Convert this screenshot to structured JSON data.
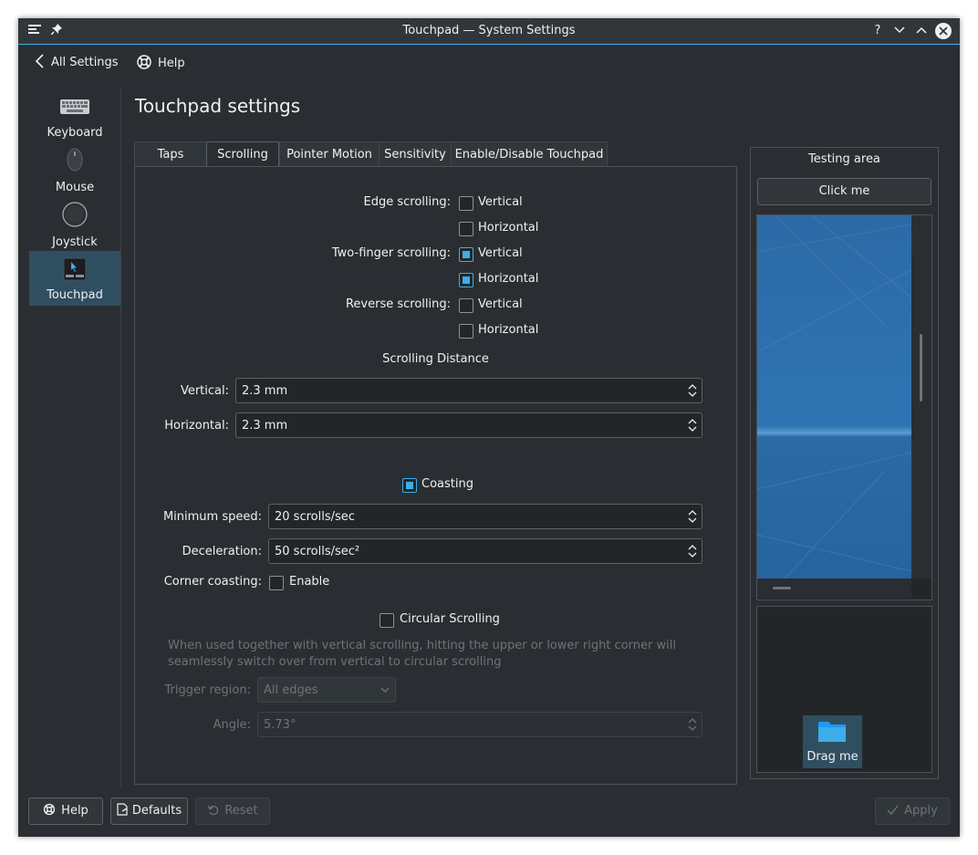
{
  "window": {
    "title": "Touchpad — System Settings"
  },
  "toolbar": {
    "back_label": "All Settings",
    "help_label": "Help"
  },
  "sidebar": {
    "items": [
      {
        "label": "Keyboard",
        "icon": "keyboard-icon",
        "selected": false
      },
      {
        "label": "Mouse",
        "icon": "mouse-icon",
        "selected": false
      },
      {
        "label": "Joystick",
        "icon": "joystick-icon",
        "selected": false
      },
      {
        "label": "Touchpad",
        "icon": "touchpad-icon",
        "selected": true
      }
    ]
  },
  "page": {
    "title": "Touchpad settings"
  },
  "tabs": [
    {
      "label": "Taps",
      "active": false
    },
    {
      "label": "Scrolling",
      "active": true
    },
    {
      "label": "Pointer Motion",
      "active": false
    },
    {
      "label": "Sensitivity",
      "active": false
    },
    {
      "label": "Enable/Disable Touchpad",
      "active": false
    }
  ],
  "scrolling": {
    "edge_label": "Edge scrolling:",
    "two_finger_label": "Two-finger scrolling:",
    "reverse_label": "Reverse scrolling:",
    "vertical": "Vertical",
    "horizontal": "Horizontal",
    "edge": {
      "vertical": false,
      "horizontal": false
    },
    "two_finger": {
      "vertical": true,
      "horizontal": true
    },
    "reverse": {
      "vertical": false,
      "horizontal": false
    },
    "distance_title": "Scrolling Distance",
    "vertical_label": "Vertical:",
    "vertical_value": "2.3 mm",
    "horizontal_label": "Horizontal:",
    "horizontal_value": "2.3 mm",
    "coasting_label": "Coasting",
    "coasting_checked": true,
    "min_speed_label": "Minimum speed:",
    "min_speed_value": "20 scrolls/sec",
    "deceleration_label": "Deceleration:",
    "deceleration_value": "50 scrolls/sec²",
    "corner_label": "Corner coasting:",
    "corner_enable": "Enable",
    "corner_checked": false,
    "circular_label": "Circular Scrolling",
    "circular_checked": false,
    "circular_help": "When used together with vertical scrolling, hitting the upper or lower right corner will seamlessly switch over from vertical to circular scrolling",
    "trigger_label": "Trigger region:",
    "trigger_value": "All edges",
    "angle_label": "Angle:",
    "angle_value": "5.73°"
  },
  "testing": {
    "title": "Testing area",
    "click_label": "Click me",
    "drag_label": "Drag me"
  },
  "bottom": {
    "help": "Help",
    "defaults": "Defaults",
    "reset": "Reset",
    "apply": "Apply"
  },
  "colors": {
    "accent": "#3daee9",
    "background": "#2a2e32",
    "selected": "#2f4f61"
  }
}
